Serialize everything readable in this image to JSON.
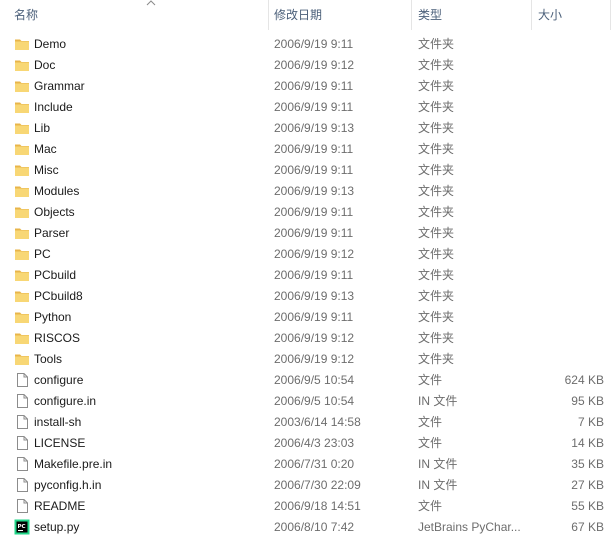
{
  "header": {
    "name_label": "名称",
    "date_label": "修改日期",
    "type_label": "类型",
    "size_label": "大小"
  },
  "colors": {
    "header_text": "#4c607a",
    "folder_yellow": "#f8d775",
    "folder_dark": "#e8b54a",
    "separator": "#e5e5e5"
  },
  "files": [
    {
      "name": "Demo",
      "date": "2006/9/19 9:11",
      "type": "文件夹",
      "size": "",
      "icon": "folder-icon"
    },
    {
      "name": "Doc",
      "date": "2006/9/19 9:12",
      "type": "文件夹",
      "size": "",
      "icon": "folder-icon"
    },
    {
      "name": "Grammar",
      "date": "2006/9/19 9:11",
      "type": "文件夹",
      "size": "",
      "icon": "folder-icon"
    },
    {
      "name": "Include",
      "date": "2006/9/19 9:11",
      "type": "文件夹",
      "size": "",
      "icon": "folder-icon"
    },
    {
      "name": "Lib",
      "date": "2006/9/19 9:13",
      "type": "文件夹",
      "size": "",
      "icon": "folder-icon"
    },
    {
      "name": "Mac",
      "date": "2006/9/19 9:11",
      "type": "文件夹",
      "size": "",
      "icon": "folder-icon"
    },
    {
      "name": "Misc",
      "date": "2006/9/19 9:11",
      "type": "文件夹",
      "size": "",
      "icon": "folder-icon"
    },
    {
      "name": "Modules",
      "date": "2006/9/19 9:13",
      "type": "文件夹",
      "size": "",
      "icon": "folder-icon"
    },
    {
      "name": "Objects",
      "date": "2006/9/19 9:11",
      "type": "文件夹",
      "size": "",
      "icon": "folder-icon"
    },
    {
      "name": "Parser",
      "date": "2006/9/19 9:11",
      "type": "文件夹",
      "size": "",
      "icon": "folder-icon"
    },
    {
      "name": "PC",
      "date": "2006/9/19 9:12",
      "type": "文件夹",
      "size": "",
      "icon": "folder-icon"
    },
    {
      "name": "PCbuild",
      "date": "2006/9/19 9:11",
      "type": "文件夹",
      "size": "",
      "icon": "folder-icon"
    },
    {
      "name": "PCbuild8",
      "date": "2006/9/19 9:13",
      "type": "文件夹",
      "size": "",
      "icon": "folder-icon"
    },
    {
      "name": "Python",
      "date": "2006/9/19 9:11",
      "type": "文件夹",
      "size": "",
      "icon": "folder-icon"
    },
    {
      "name": "RISCOS",
      "date": "2006/9/19 9:12",
      "type": "文件夹",
      "size": "",
      "icon": "folder-icon"
    },
    {
      "name": "Tools",
      "date": "2006/9/19 9:12",
      "type": "文件夹",
      "size": "",
      "icon": "folder-icon"
    },
    {
      "name": "configure",
      "date": "2006/9/5 10:54",
      "type": "文件",
      "size": "624 KB",
      "icon": "file-icon"
    },
    {
      "name": "configure.in",
      "date": "2006/9/5 10:54",
      "type": "IN 文件",
      "size": "95 KB",
      "icon": "file-icon"
    },
    {
      "name": "install-sh",
      "date": "2003/6/14 14:58",
      "type": "文件",
      "size": "7 KB",
      "icon": "file-icon"
    },
    {
      "name": "LICENSE",
      "date": "2006/4/3 23:03",
      "type": "文件",
      "size": "14 KB",
      "icon": "file-icon"
    },
    {
      "name": "Makefile.pre.in",
      "date": "2006/7/31 0:20",
      "type": "IN 文件",
      "size": "35 KB",
      "icon": "file-icon"
    },
    {
      "name": "pyconfig.h.in",
      "date": "2006/7/30 22:09",
      "type": "IN 文件",
      "size": "27 KB",
      "icon": "file-icon"
    },
    {
      "name": "README",
      "date": "2006/9/18 14:51",
      "type": "文件",
      "size": "55 KB",
      "icon": "file-icon"
    },
    {
      "name": "setup.py",
      "date": "2006/8/10 7:42",
      "type": "JetBrains PyChar...",
      "size": "67 KB",
      "icon": "pycharm-icon"
    }
  ]
}
